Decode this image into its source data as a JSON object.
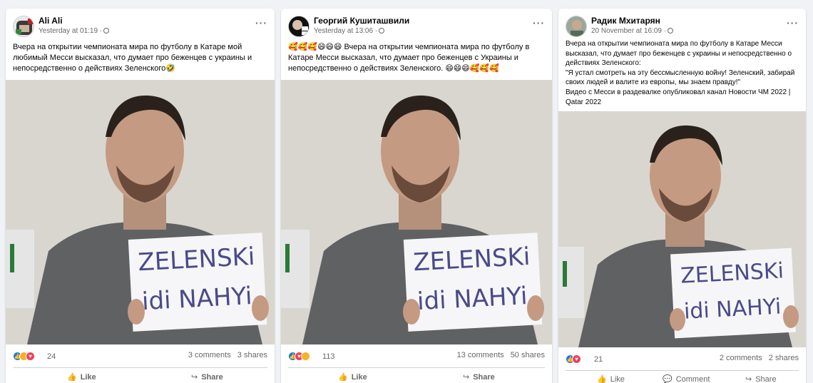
{
  "posts": [
    {
      "author": "Ali Ali",
      "time": "Yesterday at 01:19 ·",
      "more_label": "···",
      "text": "Вчера на открытии чемпионата мира по футболу в Катаре мой любимый Месси высказал, что думает про беженцев с украины и непосредственно о действиях Зеленского🤣",
      "sign_line1": "ZELENSKi",
      "sign_line2": "idi NAHYi",
      "reaction_count": "24",
      "comments": "3 comments",
      "shares": "3 shares",
      "like_label": "Like",
      "share_label": "Share"
    },
    {
      "author": "Георгий Кушиташвили",
      "time": "Yesterday at 13:06 ·",
      "more_label": "···",
      "text": "🥰🥰🥰😄😄😄   Вчера на открытии чемпионата мира по футболу в Катаре Месси высказал, что думает про беженцев с Украины и непосредственно о действиях Зеленского.   😄😄😄🥰🥰🥰",
      "sign_line1": "ZELENSKi",
      "sign_line2": "idi NAHYi",
      "reaction_count": "113",
      "comments": "13 comments",
      "shares": "50 shares",
      "like_label": "Like",
      "share_label": "Share"
    },
    {
      "author": "Радик Мхитарян",
      "time": "20 November at 16:09 ·",
      "more_label": "···",
      "text_lines": [
        "Вчера на открытии чемпионата мира по футболу в Катаре Месси высказал, что думает про беженцев с украины и непосредственно о действиях Зеленского:",
        "\"Я устал смотреть на эту бессмысленную войну! Зеленский, забирай своих людей и валите из европы, мы знаем правду!\"",
        "Видео с Месси в раздевалке опубликовал канал Новости ЧМ 2022 | Qatar 2022"
      ],
      "sign_line1": "ZELENSKi",
      "sign_line2": "idi NAHYi",
      "reaction_count": "21",
      "comments": "2 comments",
      "shares": "2 shares",
      "like_label": "Like",
      "comment_label": "Comment",
      "share_label": "Share"
    }
  ],
  "colors": {
    "background": "#f0f2f5",
    "like_blue": "#1877f2",
    "love_red": "#f33e58",
    "haha_yellow": "#f7b125",
    "secondary_text": "#65676b"
  }
}
